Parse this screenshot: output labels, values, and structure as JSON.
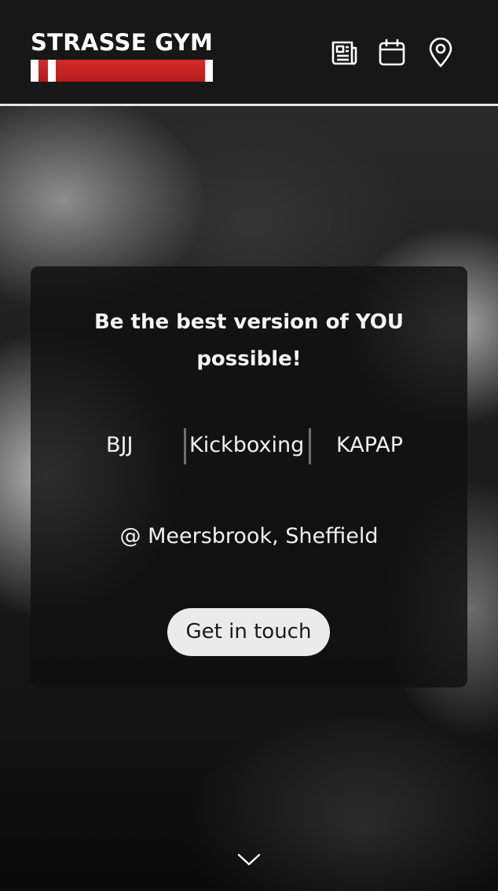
{
  "brand": {
    "name": "STRASSE GYM",
    "belt_color": "#c92222"
  },
  "nav": {
    "items": [
      {
        "icon": "newspaper-icon"
      },
      {
        "icon": "calendar-icon"
      },
      {
        "icon": "map-pin-icon"
      }
    ]
  },
  "hero": {
    "tagline_line1": "Be the best version of YOU",
    "tagline_line2": "possible!",
    "disciplines": [
      "BJJ",
      "Kickboxing",
      "KAPAP"
    ],
    "location": "@ Meersbrook, Sheffield",
    "cta_label": "Get in touch",
    "scroll_icon": "chevron-down-icon"
  },
  "colors": {
    "header_bg": "#171717",
    "card_bg": "#101010",
    "cta_bg": "#ebebeb",
    "accent_red": "#c92222"
  }
}
